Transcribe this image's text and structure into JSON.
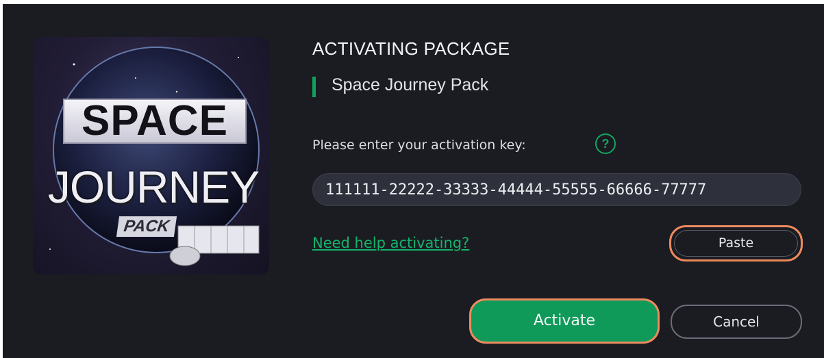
{
  "dialog": {
    "title": "ACTIVATING PACKAGE",
    "package_name": "Space Journey Pack",
    "key_label": "Please enter your activation key:",
    "help_icon_glyph": "?",
    "activation_key_value": "111111-22222-33333-44444-55555-66666-77777",
    "help_link": "Need help activating?",
    "paste_label": "Paste",
    "activate_label": "Activate",
    "cancel_label": "Cancel"
  },
  "artwork": {
    "word_1": "SPACE",
    "word_2": "JOURNEY",
    "word_3": "PACK"
  },
  "icons": {
    "help": "help-circle-icon"
  },
  "colors": {
    "background": "#1a1c22",
    "accent_green": "#0f9a5a",
    "link_green": "#14b46a",
    "focus_orange": "#ee8a5e"
  }
}
